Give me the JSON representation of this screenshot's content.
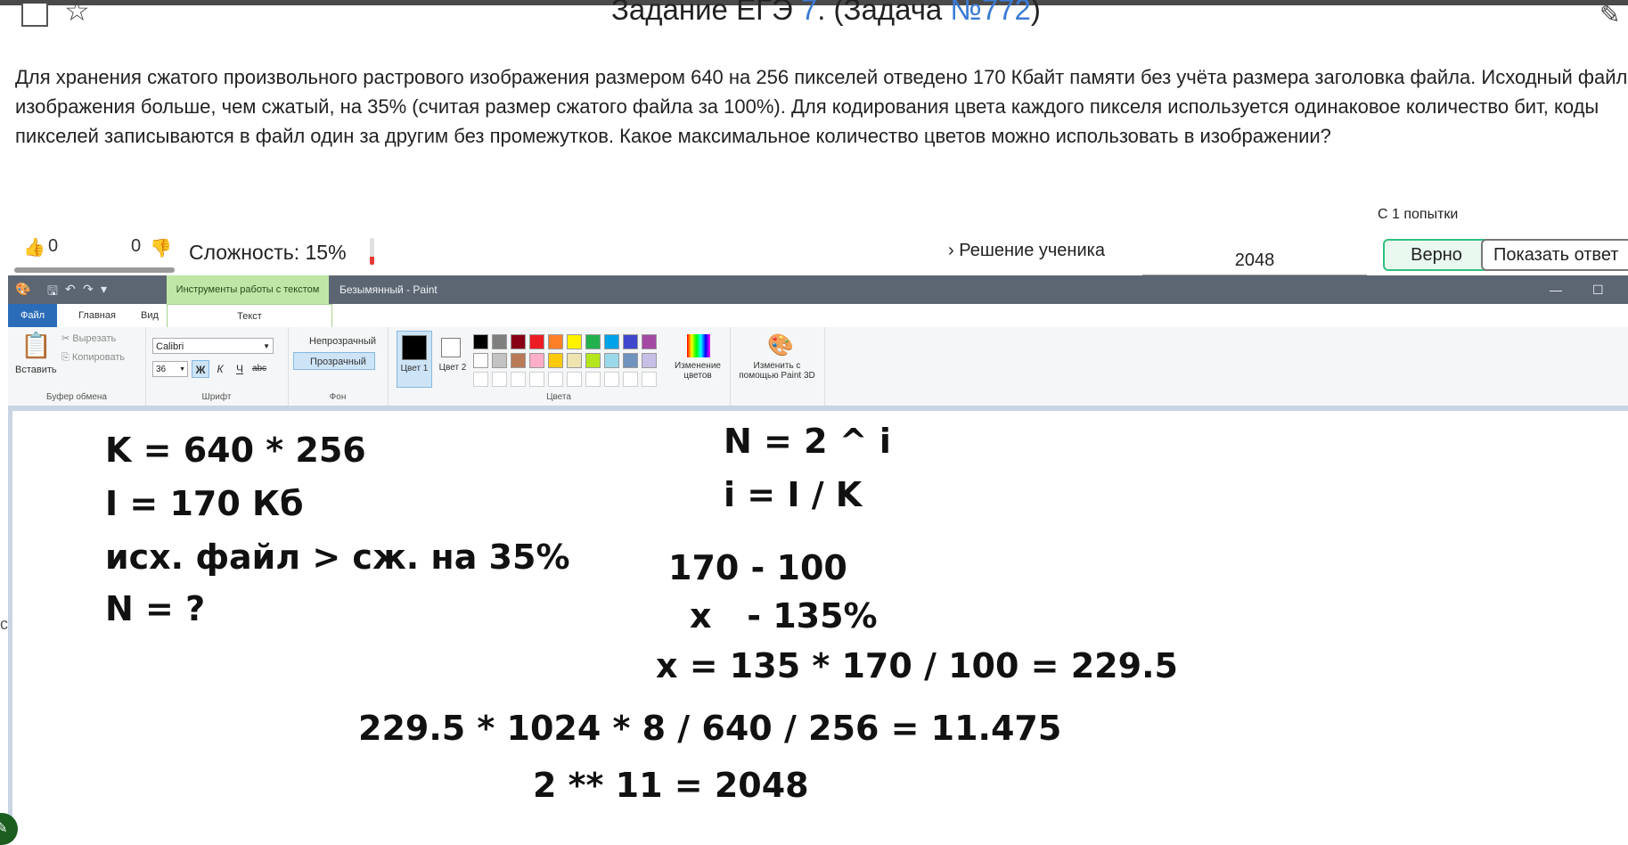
{
  "header": {
    "title_prefix": "Задание ЕГЭ ",
    "title_number": "7",
    "title_middle": ". (Задача ",
    "title_task": "№772",
    "title_suffix": ")"
  },
  "problem_text": "Для хранения сжатого произвольного растрового изображения размером 640 на 256 пикселей отведено 170 Кбайт памяти без учёта размера заголовка файла. Исходный файл изображения больше, чем сжатый, на 35% (считая размер сжатого файла за 100%). Для кодирования цвета каждого пикселя используется одинаковое количество бит, коды пикселей записываются в файл один за другим без промежутков. Какое максимальное количество цветов можно использовать в изображении?",
  "stats": {
    "likes": "0",
    "dislikes": "0",
    "difficulty_label": "Сложность: 15%",
    "difficulty_value": 0.15,
    "attempts": "С 1 попытки"
  },
  "answer": {
    "solution_link": "Решение ученика",
    "value": "2048",
    "correct_label": "Верно",
    "show_answer_label": "Показать ответ"
  },
  "paint": {
    "context_tab": "Инструменты работы с текстом",
    "window_title": "Безымянный - Paint",
    "tabs": [
      "Файл",
      "Главная",
      "Вид",
      "Текст"
    ],
    "clipboard": {
      "paste": "Вставить",
      "cut": "Вырезать",
      "copy": "Копировать",
      "label": "Буфер обмена"
    },
    "font": {
      "family": "Calibri",
      "size": "36",
      "bold": "Ж",
      "italic": "К",
      "underline": "Ч",
      "strike": "abc",
      "label": "Шрифт"
    },
    "background": {
      "opaque": "Непрозрачный",
      "transparent": "Прозрачный",
      "label": "Фон"
    },
    "colors": {
      "color1": "Цвет 1",
      "color2": "Цвет 2",
      "edit": "Изменение цветов",
      "label": "Цвета",
      "palette_row1": [
        "#000000",
        "#7f7f7f",
        "#880015",
        "#ed1c24",
        "#ff7f27",
        "#fff200",
        "#22b14c",
        "#00a2e8",
        "#3f48cc",
        "#a349a4"
      ],
      "palette_row2": [
        "#ffffff",
        "#c3c3c3",
        "#b97a57",
        "#ffaec9",
        "#ffc90e",
        "#efe4b0",
        "#b5e61d",
        "#99d9ea",
        "#7092be",
        "#c8bfe7"
      ]
    },
    "paint3d": "Изменить с помощью Paint 3D"
  },
  "notes": {
    "k": "K = 640 * 256",
    "i_total": "I = 170 Кб",
    "cond": "исх. файл > сж. на 35%",
    "n_q": "N = ?",
    "n_formula": "N = 2 ^ i",
    "i_formula": "i = I / K",
    "prop1": "170 - 100",
    "prop2": "x   - 135%",
    "x_calc": "x = 135 * 170 / 100 = 229.5",
    "bits_calc": "229.5 * 1024 * 8 / 640 / 256 = 11.475",
    "result": "2 ** 11 = 2048"
  }
}
